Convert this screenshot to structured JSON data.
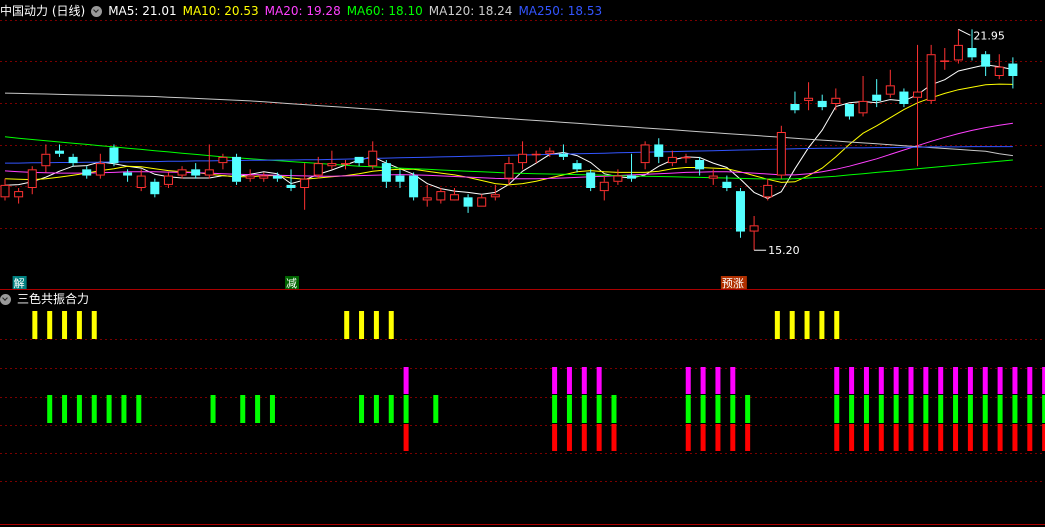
{
  "main_panel": {
    "title": "中国动力 (日线)",
    "ma_items": [
      {
        "label": "MA5: 21.01",
        "color": "#ffffff"
      },
      {
        "label": "MA10: 20.53",
        "color": "#ffff00"
      },
      {
        "label": "MA20: 19.28",
        "color": "#ff40ff"
      },
      {
        "label": "MA60: 18.10",
        "color": "#00ff00"
      },
      {
        "label": "MA120: 18.24",
        "color": "#cccccc"
      },
      {
        "label": "MA250: 18.53",
        "color": "#3355ff"
      }
    ],
    "high_label": "21.95",
    "low_label": "15.20",
    "signals": [
      {
        "text": "解",
        "bg": "#008080",
        "fg": "#ffffff",
        "index": 1
      },
      {
        "text": "减",
        "bg": "#006400",
        "fg": "#ffffff",
        "index": 21
      },
      {
        "text": "预涨",
        "bg": "#b03000",
        "fg": "#ffffff",
        "index": 53
      }
    ]
  },
  "sub_panel": {
    "title": "三色共振合力"
  },
  "colors": {
    "up": "#ff3232",
    "down": "#54ffff",
    "grid": "#7a0000",
    "border": "#aa0000",
    "yellow": "#ffff00",
    "magenta": "#ff00ff",
    "green": "#00ff00",
    "red": "#ff0000"
  },
  "chart_data": {
    "type": "candlestick",
    "ylim": [
      14.5,
      22.6
    ],
    "candles": [
      [
        16.9,
        17.3,
        17.5,
        16.8
      ],
      [
        16.9,
        17.1,
        17.2,
        16.7
      ],
      [
        17.2,
        17.8,
        17.9,
        17.0
      ],
      [
        17.9,
        18.3,
        18.6,
        17.7
      ],
      [
        18.4,
        18.3,
        18.6,
        18.2
      ],
      [
        18.2,
        18.0,
        18.3,
        17.9
      ],
      [
        17.8,
        17.6,
        17.9,
        17.5
      ],
      [
        17.6,
        18.0,
        18.3,
        17.5
      ],
      [
        18.5,
        18.0,
        18.6,
        17.9
      ],
      [
        17.7,
        17.6,
        17.8,
        17.4
      ],
      [
        17.2,
        17.6,
        17.8,
        17.1
      ],
      [
        17.4,
        17.0,
        17.5,
        16.9
      ],
      [
        17.3,
        17.6,
        17.7,
        17.2
      ],
      [
        17.6,
        17.8,
        17.9,
        17.5
      ],
      [
        17.8,
        17.6,
        18.0,
        17.5
      ],
      [
        17.6,
        17.8,
        18.6,
        17.5
      ],
      [
        18.0,
        18.2,
        18.3,
        17.8
      ],
      [
        18.2,
        17.4,
        18.3,
        17.3
      ],
      [
        17.5,
        17.6,
        17.8,
        17.4
      ],
      [
        17.5,
        17.6,
        17.7,
        17.4
      ],
      [
        17.6,
        17.5,
        17.7,
        17.4
      ],
      [
        17.3,
        17.2,
        17.8,
        17.1
      ],
      [
        17.2,
        17.5,
        18.0,
        16.5
      ],
      [
        17.6,
        18.0,
        18.2,
        17.5
      ],
      [
        17.9,
        18.0,
        18.4,
        17.8
      ],
      [
        18.0,
        18.0,
        18.1,
        17.8
      ],
      [
        18.2,
        18.0,
        18.2,
        17.9
      ],
      [
        17.9,
        18.4,
        18.7,
        17.8
      ],
      [
        18.0,
        17.4,
        18.1,
        17.2
      ],
      [
        17.6,
        17.4,
        17.8,
        17.2
      ],
      [
        17.6,
        16.9,
        17.7,
        16.8
      ],
      [
        16.8,
        16.9,
        17.3,
        16.6
      ],
      [
        16.8,
        17.1,
        17.2,
        16.7
      ],
      [
        16.8,
        17.0,
        17.2,
        16.9
      ],
      [
        16.9,
        16.6,
        17.0,
        16.4
      ],
      [
        16.6,
        16.9,
        17.0,
        16.6
      ],
      [
        16.9,
        17.0,
        17.3,
        16.8
      ],
      [
        17.5,
        18.0,
        18.2,
        17.3
      ],
      [
        18.0,
        18.3,
        18.7,
        17.8
      ],
      [
        18.3,
        18.3,
        18.4,
        18.0
      ],
      [
        18.3,
        18.4,
        18.5,
        18.2
      ],
      [
        18.3,
        18.2,
        18.6,
        18.1
      ],
      [
        18.0,
        17.8,
        18.1,
        17.7
      ],
      [
        17.7,
        17.2,
        17.8,
        17.1
      ],
      [
        17.1,
        17.4,
        17.6,
        16.8
      ],
      [
        17.4,
        17.6,
        17.8,
        17.3
      ],
      [
        17.6,
        17.5,
        18.3,
        17.4
      ],
      [
        18.0,
        18.6,
        18.7,
        17.8
      ],
      [
        18.6,
        18.2,
        18.8,
        18.0
      ],
      [
        18.0,
        18.2,
        18.4,
        17.9
      ],
      [
        18.2,
        18.2,
        18.3,
        18.0
      ],
      [
        18.1,
        17.8,
        18.2,
        17.6
      ],
      [
        17.5,
        17.6,
        17.8,
        17.3
      ],
      [
        17.4,
        17.2,
        17.6,
        17.1
      ],
      [
        17.1,
        15.8,
        17.2,
        15.6
      ],
      [
        15.8,
        16.0,
        16.3,
        15.2
      ],
      [
        16.9,
        17.3,
        17.5,
        16.8
      ],
      [
        17.6,
        19.0,
        19.2,
        17.5
      ],
      [
        19.9,
        19.7,
        20.3,
        19.6
      ],
      [
        20.0,
        20.1,
        20.6,
        19.7
      ],
      [
        20.0,
        19.8,
        20.2,
        19.7
      ],
      [
        19.9,
        20.1,
        20.4,
        19.7
      ],
      [
        19.9,
        19.5,
        19.9,
        19.4
      ],
      [
        19.6,
        20.0,
        20.8,
        19.5
      ],
      [
        20.2,
        20.0,
        20.7,
        19.8
      ],
      [
        20.2,
        20.5,
        21.0,
        20.1
      ],
      [
        20.3,
        19.9,
        20.4,
        19.8
      ],
      [
        20.1,
        20.3,
        21.8,
        17.9
      ],
      [
        20.0,
        21.5,
        21.8,
        19.9
      ],
      [
        21.3,
        21.3,
        21.7,
        21.0
      ],
      [
        21.3,
        21.8,
        22.3,
        21.2
      ],
      [
        21.7,
        21.4,
        22.3,
        21.3
      ],
      [
        21.5,
        21.1,
        21.6,
        20.8
      ],
      [
        20.8,
        21.1,
        21.5,
        20.7
      ],
      [
        21.2,
        20.8,
        21.4,
        20.4
      ]
    ],
    "ma_series": [
      {
        "name": "MA5",
        "color": "#ffffff",
        "values": [
          17.29,
          17.31,
          17.4,
          17.55,
          17.74,
          17.9,
          17.92,
          18.04,
          17.98,
          17.9,
          17.84,
          17.64,
          17.56,
          17.52,
          17.52,
          17.52,
          17.6,
          17.56,
          17.64,
          17.72,
          17.66,
          17.34,
          17.46,
          17.64,
          17.78,
          17.94,
          18.1,
          18.2,
          18.0,
          17.82,
          17.64,
          17.34,
          17.18,
          17.1,
          17.06,
          17.0,
          17.06,
          17.32,
          17.74,
          18.0,
          18.28,
          18.34,
          18.24,
          18.02,
          17.66,
          17.56,
          17.52,
          17.62,
          17.9,
          18.1,
          18.2,
          18.18,
          18.0,
          17.86,
          17.48,
          17.06,
          16.86,
          17.08,
          17.82,
          18.5,
          19.06,
          19.82,
          19.94,
          19.98,
          19.94,
          20.04,
          20.0,
          20.2,
          20.52,
          20.68,
          20.96,
          21.06,
          21.16,
          21.1,
          21.01
        ]
      },
      {
        "name": "MA10",
        "color": "#ffff00",
        "values": [
          17.5,
          17.48,
          17.47,
          17.5,
          17.55,
          17.61,
          17.68,
          17.76,
          17.82,
          17.9,
          17.88,
          17.82,
          17.76,
          17.72,
          17.7,
          17.64,
          17.6,
          17.56,
          17.56,
          17.6,
          17.6,
          17.52,
          17.48,
          17.52,
          17.56,
          17.6,
          17.66,
          17.74,
          17.78,
          17.8,
          17.8,
          17.74,
          17.68,
          17.62,
          17.54,
          17.44,
          17.34,
          17.3,
          17.34,
          17.42,
          17.52,
          17.62,
          17.72,
          17.76,
          17.72,
          17.7,
          17.7,
          17.7,
          17.74,
          17.82,
          17.86,
          17.86,
          17.84,
          17.82,
          17.72,
          17.6,
          17.48,
          17.38,
          17.4,
          17.6,
          17.84,
          18.2,
          18.6,
          18.96,
          19.2,
          19.46,
          19.72,
          19.94,
          20.1,
          20.24,
          20.36,
          20.44,
          20.52,
          20.54,
          20.53
        ]
      },
      {
        "name": "MA20",
        "color": "#ff40ff",
        "values": [
          17.75,
          17.72,
          17.7,
          17.69,
          17.68,
          17.68,
          17.68,
          17.69,
          17.7,
          17.72,
          17.72,
          17.72,
          17.71,
          17.7,
          17.69,
          17.68,
          17.66,
          17.64,
          17.63,
          17.62,
          17.61,
          17.6,
          17.59,
          17.58,
          17.58,
          17.59,
          17.6,
          17.61,
          17.62,
          17.63,
          17.62,
          17.61,
          17.59,
          17.57,
          17.55,
          17.53,
          17.51,
          17.5,
          17.5,
          17.5,
          17.51,
          17.52,
          17.54,
          17.56,
          17.58,
          17.6,
          17.62,
          17.64,
          17.66,
          17.68,
          17.7,
          17.71,
          17.72,
          17.72,
          17.7,
          17.68,
          17.65,
          17.62,
          17.62,
          17.66,
          17.72,
          17.8,
          17.9,
          18.02,
          18.14,
          18.28,
          18.42,
          18.56,
          18.7,
          18.83,
          18.95,
          19.05,
          19.14,
          19.22,
          19.28
        ]
      },
      {
        "name": "MA60",
        "color": "#00ff00",
        "values": [
          18.85,
          18.8,
          18.76,
          18.72,
          18.68,
          18.64,
          18.6,
          18.56,
          18.52,
          18.48,
          18.44,
          18.4,
          18.36,
          18.32,
          18.28,
          18.24,
          18.2,
          18.17,
          18.14,
          18.11,
          18.08,
          18.05,
          18.02,
          17.99,
          17.96,
          17.93,
          17.9,
          17.88,
          17.86,
          17.84,
          17.82,
          17.8,
          17.78,
          17.76,
          17.74,
          17.72,
          17.7,
          17.68,
          17.67,
          17.66,
          17.65,
          17.64,
          17.63,
          17.62,
          17.61,
          17.6,
          17.59,
          17.58,
          17.57,
          17.56,
          17.55,
          17.54,
          17.53,
          17.52,
          17.51,
          17.5,
          17.49,
          17.49,
          17.5,
          17.52,
          17.55,
          17.58,
          17.62,
          17.66,
          17.7,
          17.74,
          17.78,
          17.82,
          17.86,
          17.9,
          17.94,
          17.98,
          18.02,
          18.06,
          18.1
        ]
      },
      {
        "name": "MA120",
        "color": "#c8c8c8",
        "values": [
          20.25,
          20.24,
          20.23,
          20.22,
          20.21,
          20.2,
          20.19,
          20.18,
          20.17,
          20.16,
          20.15,
          20.14,
          20.12,
          20.1,
          20.08,
          20.06,
          20.04,
          20.02,
          20.0,
          19.97,
          19.94,
          19.91,
          19.88,
          19.85,
          19.82,
          19.79,
          19.76,
          19.73,
          19.7,
          19.67,
          19.64,
          19.61,
          19.58,
          19.55,
          19.52,
          19.49,
          19.46,
          19.43,
          19.4,
          19.37,
          19.34,
          19.31,
          19.28,
          19.25,
          19.22,
          19.19,
          19.16,
          19.13,
          19.1,
          19.07,
          19.04,
          19.01,
          18.98,
          18.95,
          18.92,
          18.89,
          18.86,
          18.83,
          18.8,
          18.77,
          18.74,
          18.71,
          18.68,
          18.65,
          18.62,
          18.59,
          18.56,
          18.53,
          18.5,
          18.47,
          18.44,
          18.41,
          18.38,
          18.3,
          18.24
        ]
      },
      {
        "name": "MA250",
        "color": "#3355ff",
        "values": [
          18.0,
          18.0,
          18.01,
          18.01,
          18.02,
          18.02,
          18.03,
          18.03,
          18.04,
          18.04,
          18.05,
          18.05,
          18.06,
          18.06,
          18.07,
          18.07,
          18.08,
          18.08,
          18.09,
          18.09,
          18.1,
          18.1,
          18.11,
          18.11,
          18.12,
          18.13,
          18.14,
          18.15,
          18.16,
          18.17,
          18.18,
          18.19,
          18.2,
          18.21,
          18.22,
          18.23,
          18.24,
          18.25,
          18.26,
          18.27,
          18.28,
          18.29,
          18.3,
          18.31,
          18.32,
          18.33,
          18.34,
          18.35,
          18.36,
          18.37,
          18.38,
          18.39,
          18.4,
          18.41,
          18.42,
          18.43,
          18.44,
          18.45,
          18.46,
          18.47,
          18.48,
          18.48,
          18.49,
          18.49,
          18.5,
          18.5,
          18.51,
          18.51,
          18.52,
          18.52,
          18.52,
          18.53,
          18.53,
          18.53,
          18.53
        ]
      }
    ],
    "resonance": {
      "yellow": [
        1,
        2,
        3,
        4,
        5,
        22,
        23,
        24,
        25,
        51,
        52,
        53,
        54,
        55
      ],
      "green": [
        2,
        3,
        4,
        5,
        6,
        7,
        8,
        13,
        15,
        16,
        17,
        23,
        24,
        25,
        26,
        28,
        36,
        37,
        38,
        39,
        40,
        45,
        46,
        47,
        48,
        49,
        55,
        56,
        57,
        58,
        59,
        60,
        61,
        62,
        63,
        64,
        65,
        66,
        67,
        68,
        69
      ],
      "magenta": [
        26,
        36,
        37,
        38,
        39,
        45,
        46,
        47,
        48,
        55,
        56,
        57,
        58,
        59,
        60,
        61,
        62,
        63,
        64,
        65,
        66,
        67,
        68,
        69
      ],
      "red": [
        26,
        36,
        37,
        38,
        39,
        40,
        45,
        46,
        47,
        48,
        49,
        55,
        56,
        57,
        58,
        59,
        60,
        61,
        62,
        63,
        64,
        65,
        66,
        67,
        68,
        69
      ]
    }
  }
}
